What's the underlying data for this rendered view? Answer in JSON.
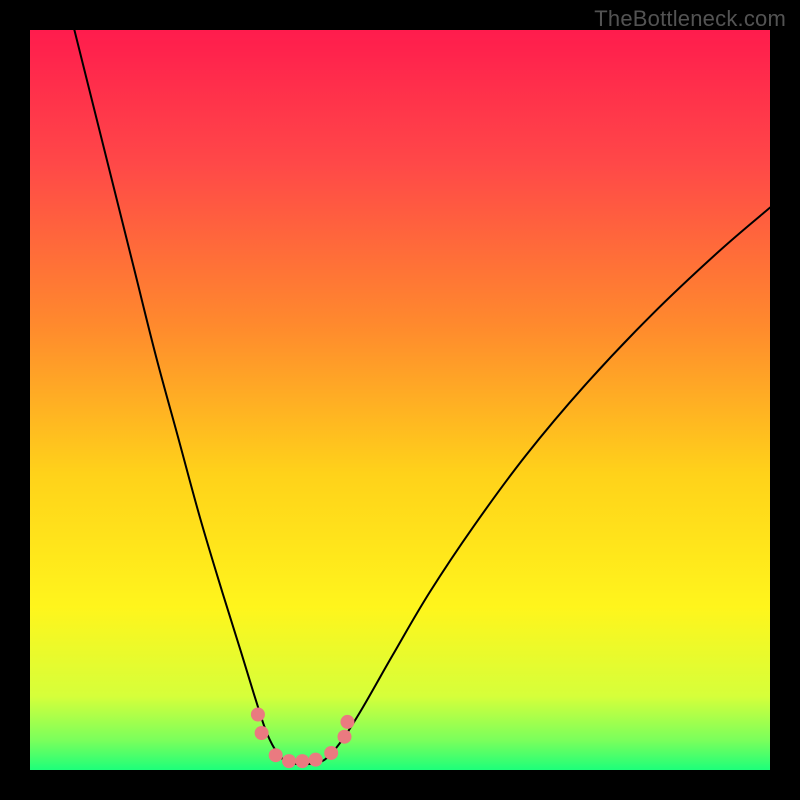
{
  "watermark": "TheBottleneck.com",
  "chart_data": {
    "type": "line",
    "title": "",
    "xlabel": "",
    "ylabel": "",
    "xlim": [
      0,
      100
    ],
    "ylim": [
      0,
      100
    ],
    "gradient_stops": [
      {
        "offset": 0,
        "color": "#ff1c4d"
      },
      {
        "offset": 18,
        "color": "#ff4848"
      },
      {
        "offset": 40,
        "color": "#ff8a2d"
      },
      {
        "offset": 60,
        "color": "#ffd21a"
      },
      {
        "offset": 78,
        "color": "#fff51c"
      },
      {
        "offset": 90,
        "color": "#d6ff3a"
      },
      {
        "offset": 96,
        "color": "#7aff5c"
      },
      {
        "offset": 100,
        "color": "#1dff7a"
      }
    ],
    "series": [
      {
        "name": "bottleneck-curve",
        "color": "#000000",
        "stroke_width": 2,
        "points": [
          {
            "x": 6.0,
            "y": 100.0
          },
          {
            "x": 8.0,
            "y": 92.0
          },
          {
            "x": 11.0,
            "y": 80.0
          },
          {
            "x": 14.0,
            "y": 68.0
          },
          {
            "x": 17.0,
            "y": 56.0
          },
          {
            "x": 20.0,
            "y": 45.0
          },
          {
            "x": 23.0,
            "y": 34.0
          },
          {
            "x": 26.0,
            "y": 24.0
          },
          {
            "x": 28.5,
            "y": 16.0
          },
          {
            "x": 30.5,
            "y": 9.5
          },
          {
            "x": 32.0,
            "y": 5.0
          },
          {
            "x": 33.5,
            "y": 2.2
          },
          {
            "x": 35.0,
            "y": 1.0
          },
          {
            "x": 37.0,
            "y": 0.8
          },
          {
            "x": 39.0,
            "y": 1.0
          },
          {
            "x": 40.5,
            "y": 2.0
          },
          {
            "x": 42.5,
            "y": 4.5
          },
          {
            "x": 45.0,
            "y": 8.5
          },
          {
            "x": 49.0,
            "y": 15.5
          },
          {
            "x": 54.0,
            "y": 24.0
          },
          {
            "x": 60.0,
            "y": 33.0
          },
          {
            "x": 67.0,
            "y": 42.5
          },
          {
            "x": 75.0,
            "y": 52.0
          },
          {
            "x": 84.0,
            "y": 61.5
          },
          {
            "x": 93.0,
            "y": 70.0
          },
          {
            "x": 100.0,
            "y": 76.0
          }
        ]
      },
      {
        "name": "valley-markers",
        "color": "#ea7a80",
        "radius": 7,
        "points": [
          {
            "x": 30.8,
            "y": 7.5
          },
          {
            "x": 31.3,
            "y": 5.0
          },
          {
            "x": 33.2,
            "y": 2.0
          },
          {
            "x": 35.0,
            "y": 1.2
          },
          {
            "x": 36.8,
            "y": 1.2
          },
          {
            "x": 38.6,
            "y": 1.4
          },
          {
            "x": 40.7,
            "y": 2.3
          },
          {
            "x": 42.5,
            "y": 4.5
          },
          {
            "x": 42.9,
            "y": 6.5
          }
        ]
      }
    ]
  }
}
